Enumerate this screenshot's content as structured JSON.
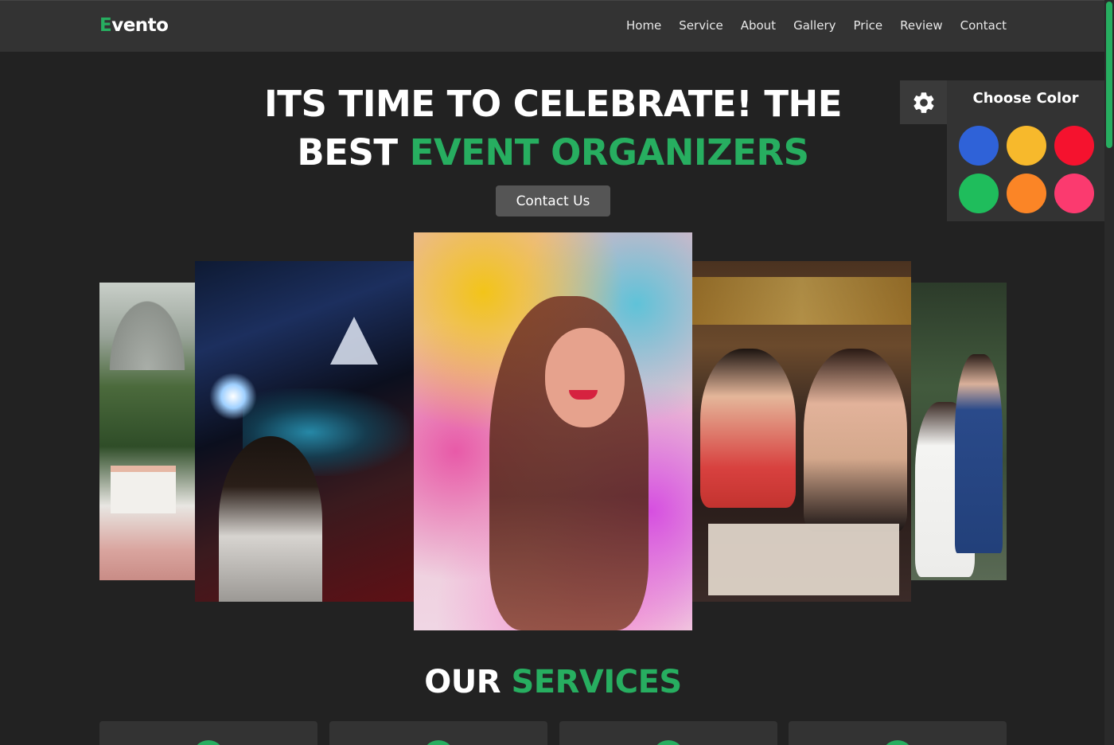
{
  "brand": {
    "first_letter": "E",
    "rest": "vento"
  },
  "nav": [
    "Home",
    "Service",
    "About",
    "Gallery",
    "Price",
    "Review",
    "Contact"
  ],
  "hero": {
    "title_part1": "ITS TIME TO CELEBRATE! THE",
    "title_part2": "BEST ",
    "title_accent": "EVENT ORGANIZERS",
    "cta_label": "Contact Us"
  },
  "color_panel": {
    "gear_icon": "gear-icon",
    "title": "Choose Color",
    "swatches": [
      "#2f62d8",
      "#f7b92c",
      "#f5122e",
      "#1fbd5c",
      "#fb8526",
      "#fb3a6f"
    ]
  },
  "slider_images": [
    "wedding-gazebo-image",
    "dj-concert-image",
    "holi-color-powder-image",
    "birthday-party-image",
    "wedding-couple-image"
  ],
  "services": {
    "title_plain": "OUR ",
    "title_accent": "SERVICES"
  },
  "colors": {
    "accent": "#27ae60",
    "background": "#222222",
    "header": "#333333"
  }
}
